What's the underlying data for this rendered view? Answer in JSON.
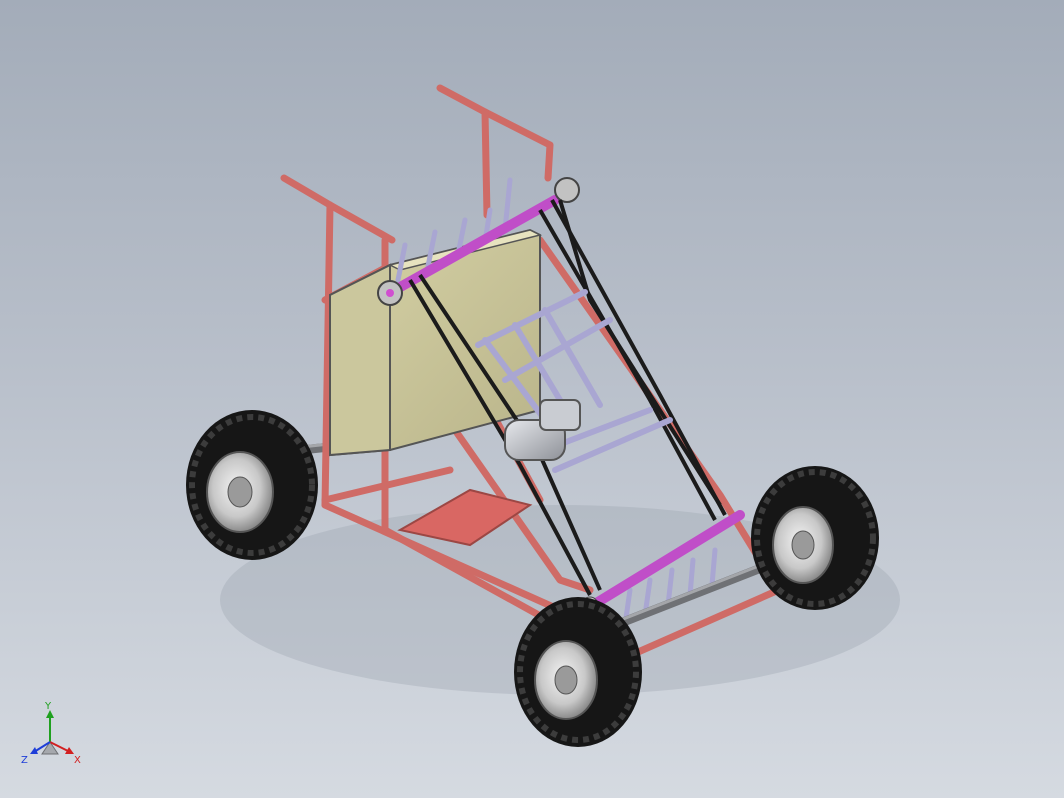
{
  "triad": {
    "x_label": "X",
    "y_label": "Y",
    "z_label": "Z",
    "x_color": "#d22020",
    "y_color": "#1fa01f",
    "z_color": "#1e3ed8"
  },
  "colors": {
    "background_top": "#a3acb9",
    "background_bottom": "#d5dae1",
    "frame": "#cf6b66",
    "hopper": "#c9c497",
    "shaft": "#c04ec8",
    "spikes": "#a9a6d2",
    "belt": "#1b1b1b",
    "tire": "#1a1a1a",
    "axle": "#7d7f83",
    "motor": "#b9bcc2"
  },
  "icons": {
    "view_triad": "view-orientation-triad-icon"
  }
}
